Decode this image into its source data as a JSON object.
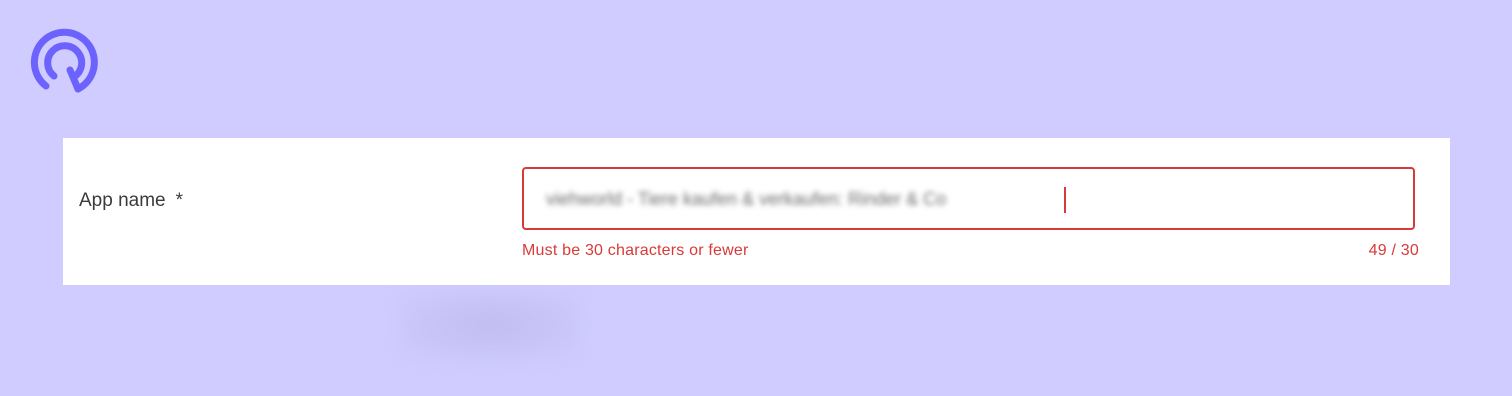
{
  "brand": {
    "logo_icon": "q-logo-icon",
    "color": "#6c63ff"
  },
  "form": {
    "label": "App name",
    "required_marker": "*",
    "input_value": "viehworld - Tiere kaufen & verkaufen: Rinder & Co",
    "error_message": "Must be 30 characters or fewer",
    "char_count": "49 / 30"
  },
  "colors": {
    "error": "#d83a37",
    "background": "#d0ccff"
  }
}
